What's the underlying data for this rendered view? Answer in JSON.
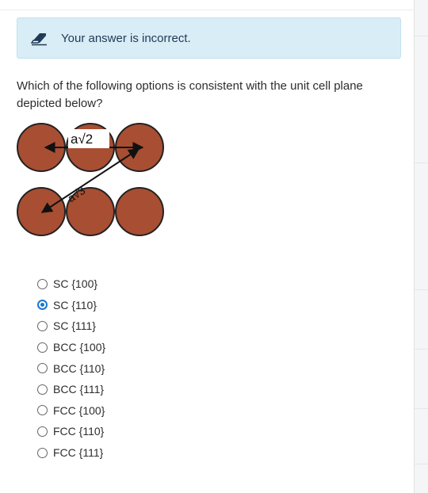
{
  "feedback": {
    "message": "Your answer is incorrect.",
    "icon": "eraser-icon",
    "background": "#d9edf7"
  },
  "question": {
    "text": "Which of the following options is consistent with the unit cell plane depicted below?"
  },
  "figure": {
    "label_top": "a√2",
    "label_diag": "a√3",
    "atom_color": "#a84e32"
  },
  "options": [
    {
      "label": "SC {100}",
      "selected": false
    },
    {
      "label": "SC {110}",
      "selected": true
    },
    {
      "label": "SC {111}",
      "selected": false
    },
    {
      "label": "BCC {100}",
      "selected": false
    },
    {
      "label": "BCC {110}",
      "selected": false
    },
    {
      "label": "BCC {111}",
      "selected": false
    },
    {
      "label": "FCC {100}",
      "selected": false
    },
    {
      "label": "FCC {110}",
      "selected": false
    },
    {
      "label": "FCC {111}",
      "selected": false
    }
  ]
}
